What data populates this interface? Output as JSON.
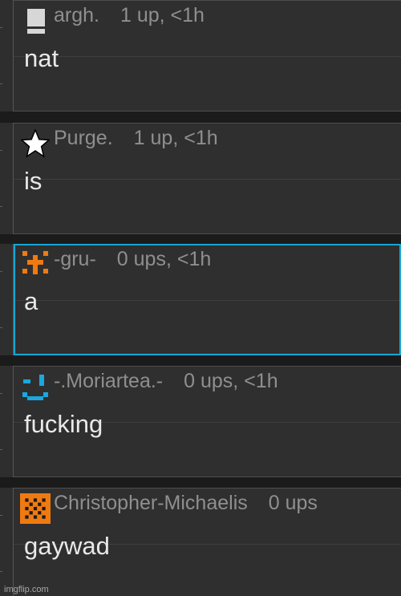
{
  "comments": [
    {
      "username": "argh.",
      "stats": "1 up, <1h",
      "text": "nat",
      "avatar_icon": "gray-block-icon",
      "selected": false
    },
    {
      "username": "Purge.",
      "stats": "1 up, <1h",
      "text": "is",
      "avatar_icon": "white-star-icon",
      "selected": false
    },
    {
      "username": "-gru-",
      "stats": "0 ups, <1h",
      "text": "a",
      "avatar_icon": "orange-pixel-cross-icon",
      "selected": true
    },
    {
      "username": "-.Moriartea.-",
      "stats": "0 ups, <1h",
      "text": "fucking",
      "avatar_icon": "blue-pixel-smiley-icon",
      "selected": false
    },
    {
      "username": "Christopher-Michaelis",
      "stats": "0 ups",
      "text": "gaywad",
      "avatar_icon": "orange-checker-icon",
      "selected": false
    }
  ],
  "colors": {
    "selected_border": "#17a6d3",
    "username": "#8f8f8f",
    "comment_text": "#e9e9e9",
    "card_background": "#2f2f2f",
    "orange_avatar": "#f07a12",
    "blue_avatar": "#19a8df"
  },
  "watermark": "imgflip.com"
}
